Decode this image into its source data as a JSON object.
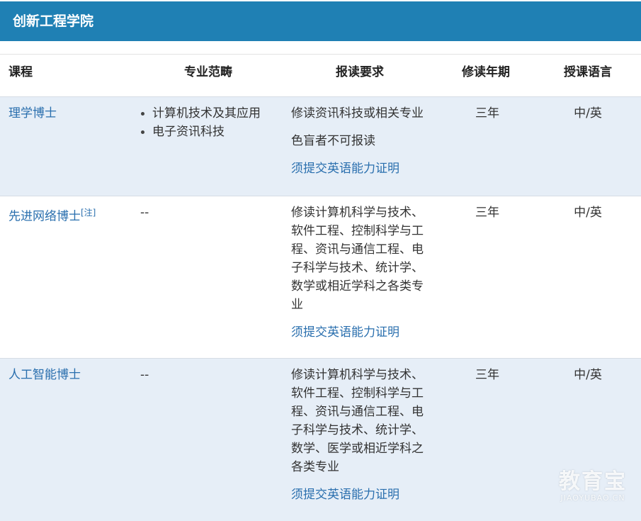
{
  "header": {
    "title": "创新工程学院"
  },
  "table": {
    "columns": {
      "course": "课程",
      "range": "专业范畴",
      "requirements": "报读要求",
      "duration": "修读年期",
      "language": "授课语言"
    },
    "rows": [
      {
        "course": "理学博士",
        "note": "",
        "range": [
          "计算机技术及其应用",
          "电子资讯科技"
        ],
        "requirements": [
          "修读资讯科技或相关专业",
          "色盲者不可报读"
        ],
        "req_link": "须提交英语能力证明",
        "duration": "三年",
        "language": "中/英"
      },
      {
        "course": "先进网络博士",
        "note": "[注]",
        "range_dash": "--",
        "requirements": [
          "修读计算机科学与技术、软件工程、控制科学与工程、资讯与通信工程、电子科学与技术、统计学、数学或相近学科之各类专业"
        ],
        "req_link": "须提交英语能力证明",
        "duration": "三年",
        "language": "中/英"
      },
      {
        "course": "人工智能博士",
        "note": "",
        "range_dash": "--",
        "requirements": [
          "修读计算机科学与技术、软件工程、控制科学与工程、资讯与通信工程、电子科学与技术、统计学、数学、医学或相近学科之各类专业"
        ],
        "req_link": "须提交英语能力证明",
        "duration": "三年",
        "language": "中/英"
      }
    ]
  },
  "watermark": {
    "main": "教育宝",
    "sub": "JIAOYUBAO.CN"
  },
  "colors": {
    "header_bg": "#1f80b4",
    "row_alt_bg": "#e6eef7",
    "link": "#2a6fae"
  }
}
